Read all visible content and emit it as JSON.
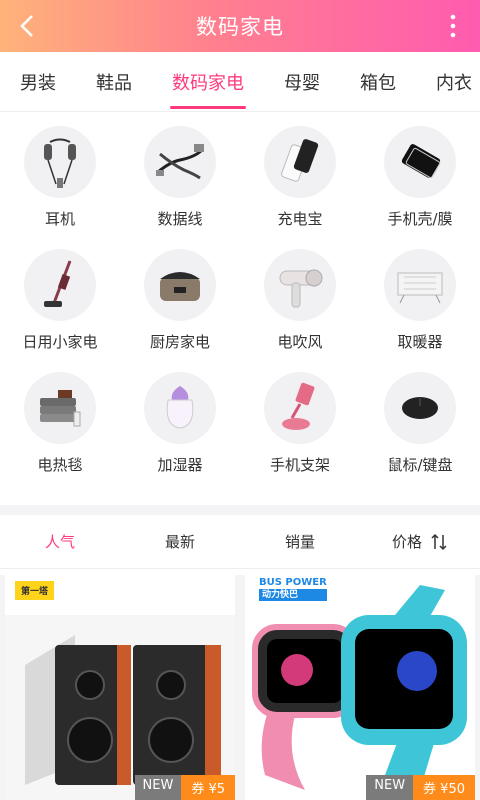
{
  "header": {
    "title": "数码家电",
    "back_icon": "chevron-left-icon",
    "more_icon": "more-vertical-icon"
  },
  "tabs": [
    {
      "label": "男装",
      "active": false
    },
    {
      "label": "鞋品",
      "active": false
    },
    {
      "label": "数码家电",
      "active": true
    },
    {
      "label": "母婴",
      "active": false
    },
    {
      "label": "箱包",
      "active": false
    },
    {
      "label": "内衣",
      "active": false
    }
  ],
  "categories": [
    {
      "label": "耳机",
      "icon": "earphones-icon"
    },
    {
      "label": "数据线",
      "icon": "data-cable-icon"
    },
    {
      "label": "充电宝",
      "icon": "power-bank-icon"
    },
    {
      "label": "手机壳/膜",
      "icon": "phone-case-icon"
    },
    {
      "label": "日用小家电",
      "icon": "vacuum-icon"
    },
    {
      "label": "厨房家电",
      "icon": "rice-cooker-icon"
    },
    {
      "label": "电吹风",
      "icon": "hair-dryer-icon"
    },
    {
      "label": "取暖器",
      "icon": "heater-icon"
    },
    {
      "label": "电热毯",
      "icon": "electric-blanket-icon"
    },
    {
      "label": "加湿器",
      "icon": "humidifier-icon"
    },
    {
      "label": "手机支架",
      "icon": "phone-stand-icon"
    },
    {
      "label": "鼠标/键盘",
      "icon": "mouse-icon"
    }
  ],
  "sort": {
    "popular": "人气",
    "newest": "最新",
    "sales": "销量",
    "price": "价格",
    "price_icon": "sort-arrows-icon"
  },
  "products": [
    {
      "brand": "第一塔",
      "new_label": "NEW",
      "coupon": "券 ¥5",
      "image": "speakers"
    },
    {
      "brand": "BUS POWER",
      "brand_sub": "动力快巴",
      "new_label": "NEW",
      "coupon": "券 ¥50",
      "image": "kids-smartwatches"
    }
  ],
  "colors": {
    "accent": "#ff3a7c",
    "header_start": "#ffb37a",
    "header_end": "#ff5bb0",
    "coupon": "#ff8c1a"
  }
}
